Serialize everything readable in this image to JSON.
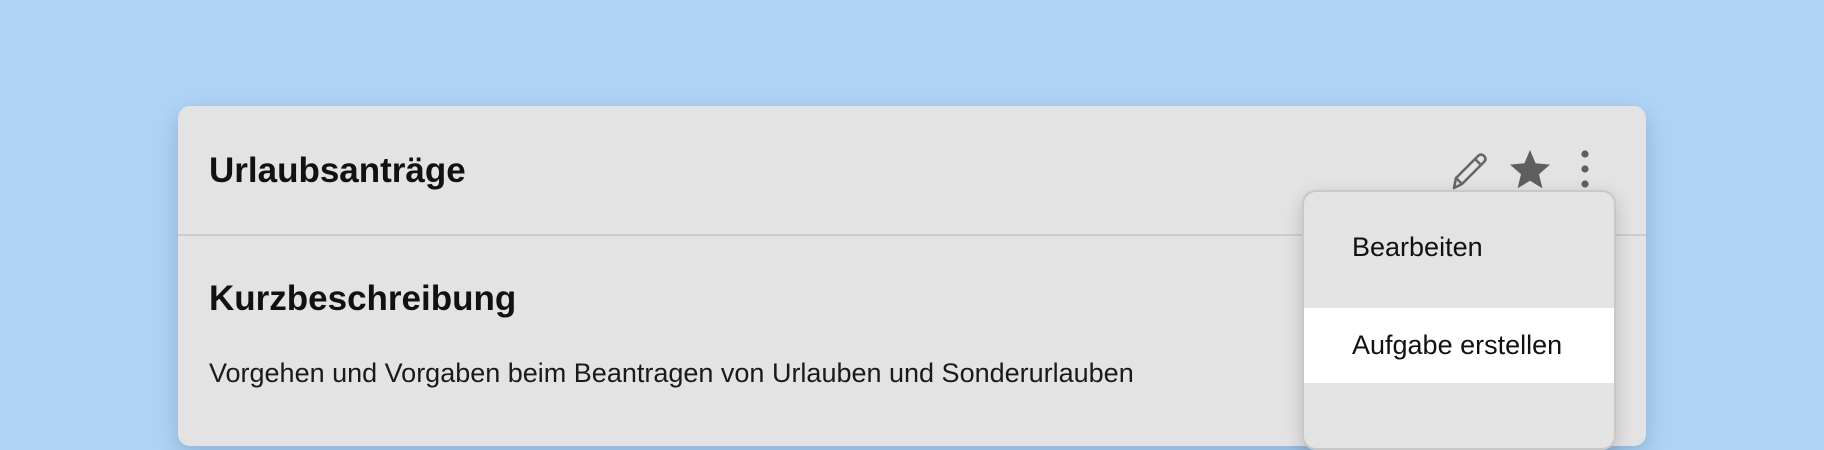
{
  "card": {
    "title": "Urlaubsanträge",
    "section_title": "Kurzbeschreibung",
    "section_text": "Vorgehen und Vorgaben beim Beantragen von Urlauben und Sonderurlauben"
  },
  "header_actions": {
    "icons": [
      "pencil-icon",
      "star-icon",
      "more-vertical-icon"
    ]
  },
  "dropdown": {
    "items": [
      {
        "label": "Bearbeiten",
        "highlighted": false
      },
      {
        "label": "Aufgabe erstellen",
        "highlighted": true
      }
    ]
  },
  "colors": {
    "background": "#b1d4f5",
    "card": "#e3e3e3",
    "highlight": "#ffffff",
    "icon": "#666666"
  }
}
